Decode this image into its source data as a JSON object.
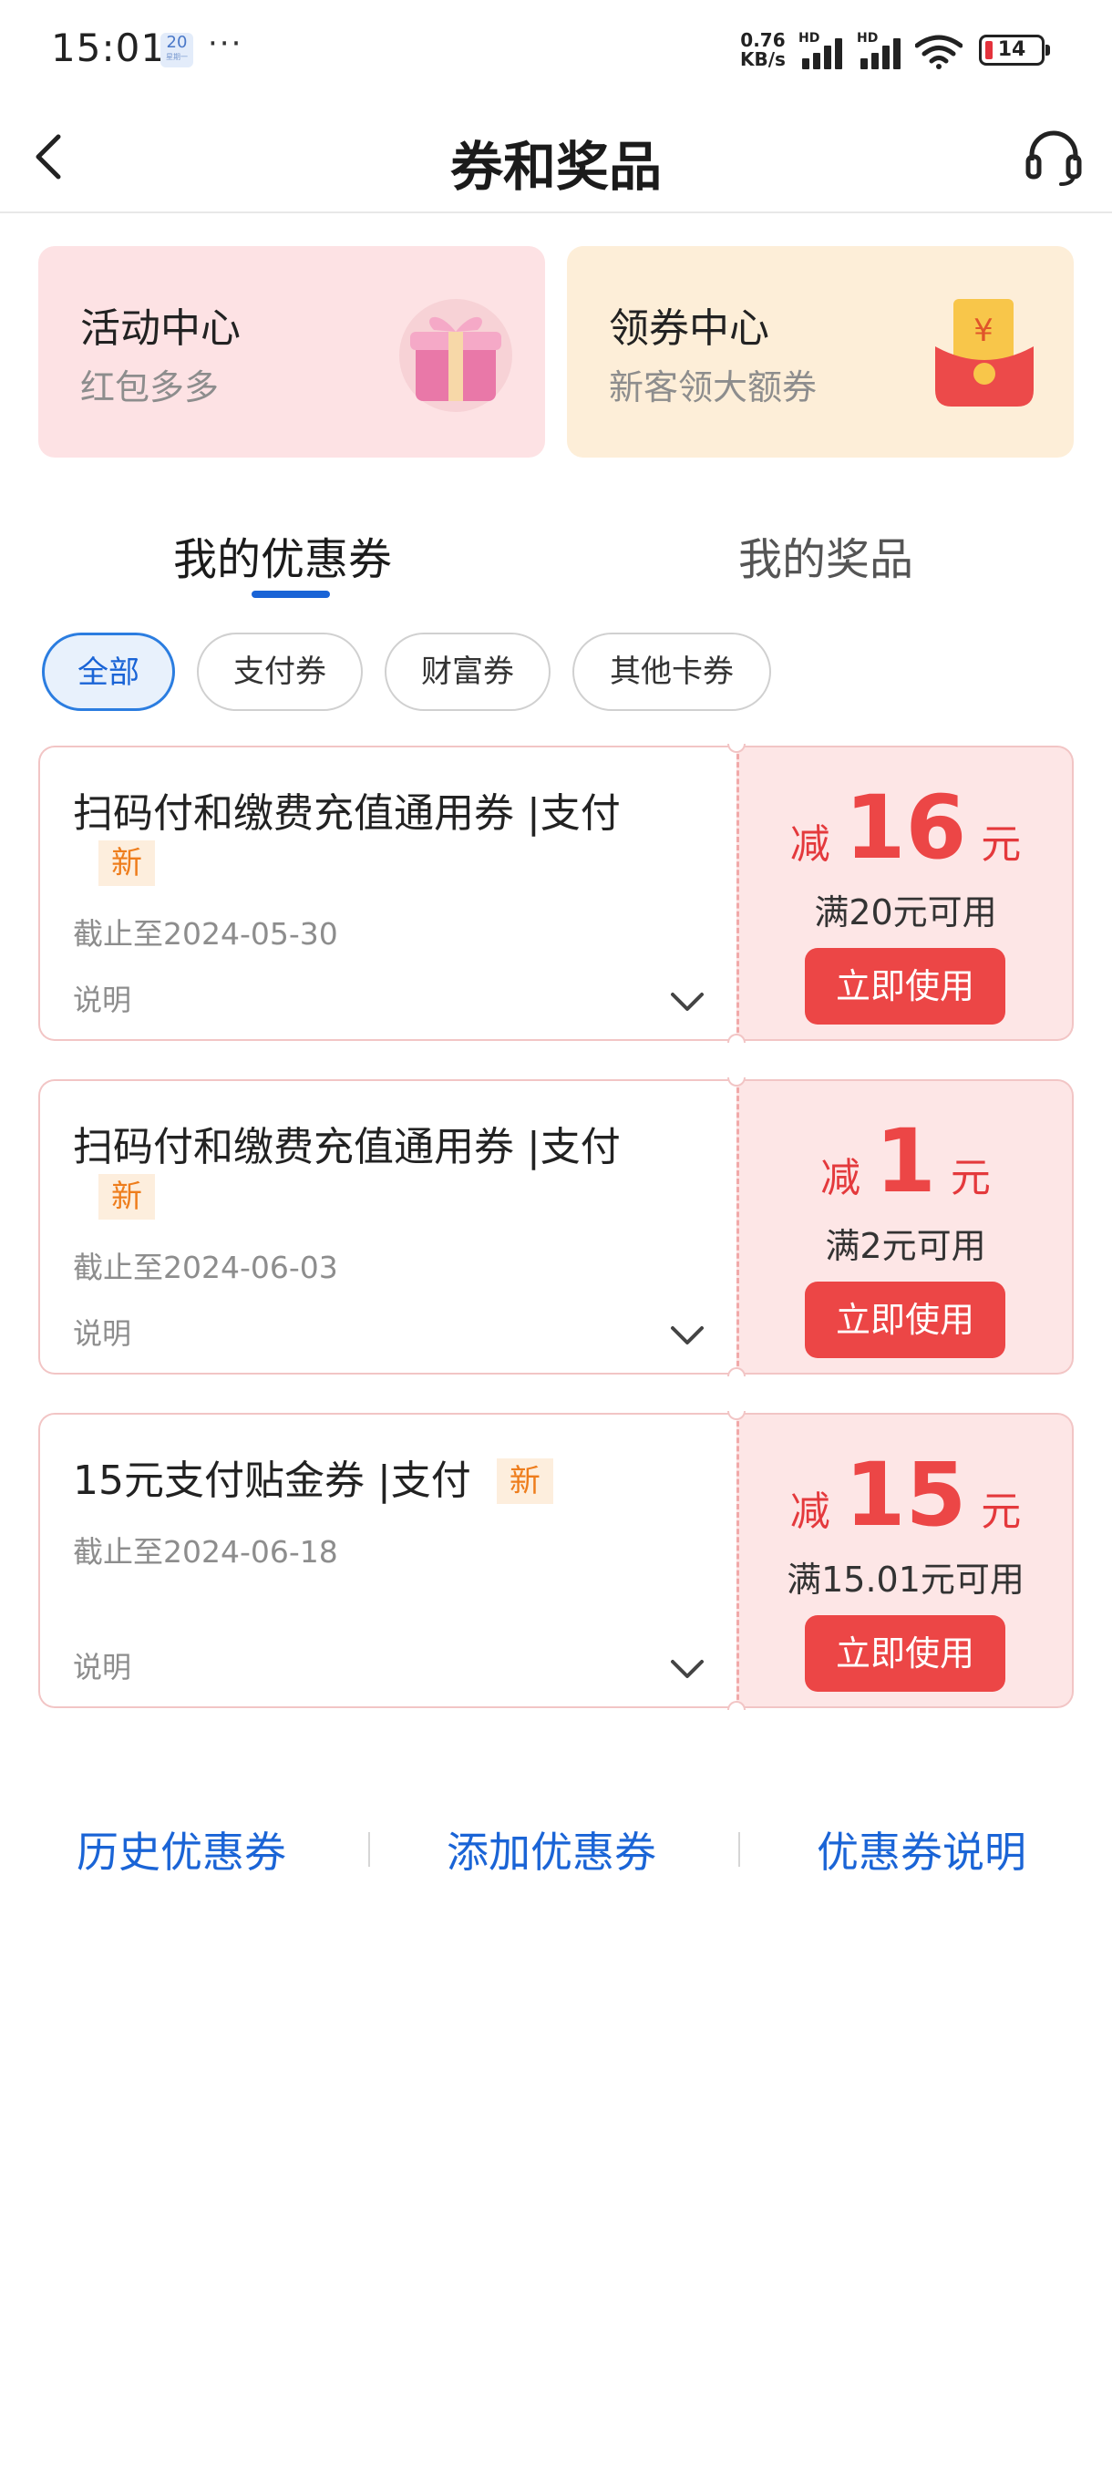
{
  "status_bar": {
    "time": "15:01",
    "calendar_day": "20",
    "calendar_sub": "星期一",
    "more": "···",
    "speed_value": "0.76",
    "speed_unit": "KB/s",
    "hd1": "HD",
    "hd2": "HD",
    "battery": "14"
  },
  "header": {
    "title": "券和奖品"
  },
  "promos": [
    {
      "title": "活动中心",
      "subtitle": "红包多多",
      "icon": "gift-box-icon"
    },
    {
      "title": "领券中心",
      "subtitle": "新客领大额券",
      "icon": "red-envelope-icon"
    }
  ],
  "tabs": [
    {
      "label": "我的优惠券",
      "active": true
    },
    {
      "label": "我的奖品",
      "active": false
    }
  ],
  "filters": [
    {
      "label": "全部",
      "active": true
    },
    {
      "label": "支付券",
      "active": false
    },
    {
      "label": "财富券",
      "active": false
    },
    {
      "label": "其他卡券",
      "active": false
    }
  ],
  "coupons": [
    {
      "name": "扫码付和缴费充值通用券 |支付",
      "badge": "新",
      "deadline": "截止至2024-05-30",
      "desc_label": "说明",
      "prefix": "减",
      "amount": "16",
      "unit": "元",
      "condition": "满20元可用",
      "action": "立即使用"
    },
    {
      "name": "扫码付和缴费充值通用券 |支付",
      "badge": "新",
      "deadline": "截止至2024-06-03",
      "desc_label": "说明",
      "prefix": "减",
      "amount": "1",
      "unit": "元",
      "condition": "满2元可用",
      "action": "立即使用"
    },
    {
      "name": "15元支付贴金券 |支付",
      "badge": "新",
      "deadline": "截止至2024-06-18",
      "desc_label": "说明",
      "prefix": "减",
      "amount": "15",
      "unit": "元",
      "condition": "满15.01元可用",
      "action": "立即使用"
    }
  ],
  "footer_links": [
    {
      "label": "历史优惠券"
    },
    {
      "label": "添加优惠券"
    },
    {
      "label": "优惠券说明"
    }
  ],
  "colors": {
    "accent_blue": "#1a64d6",
    "coupon_red": "#ec4646",
    "new_badge_orange": "#ee7d1c",
    "activity_bg": "#fde2e4",
    "coupon_center_bg": "#fdeed8"
  }
}
